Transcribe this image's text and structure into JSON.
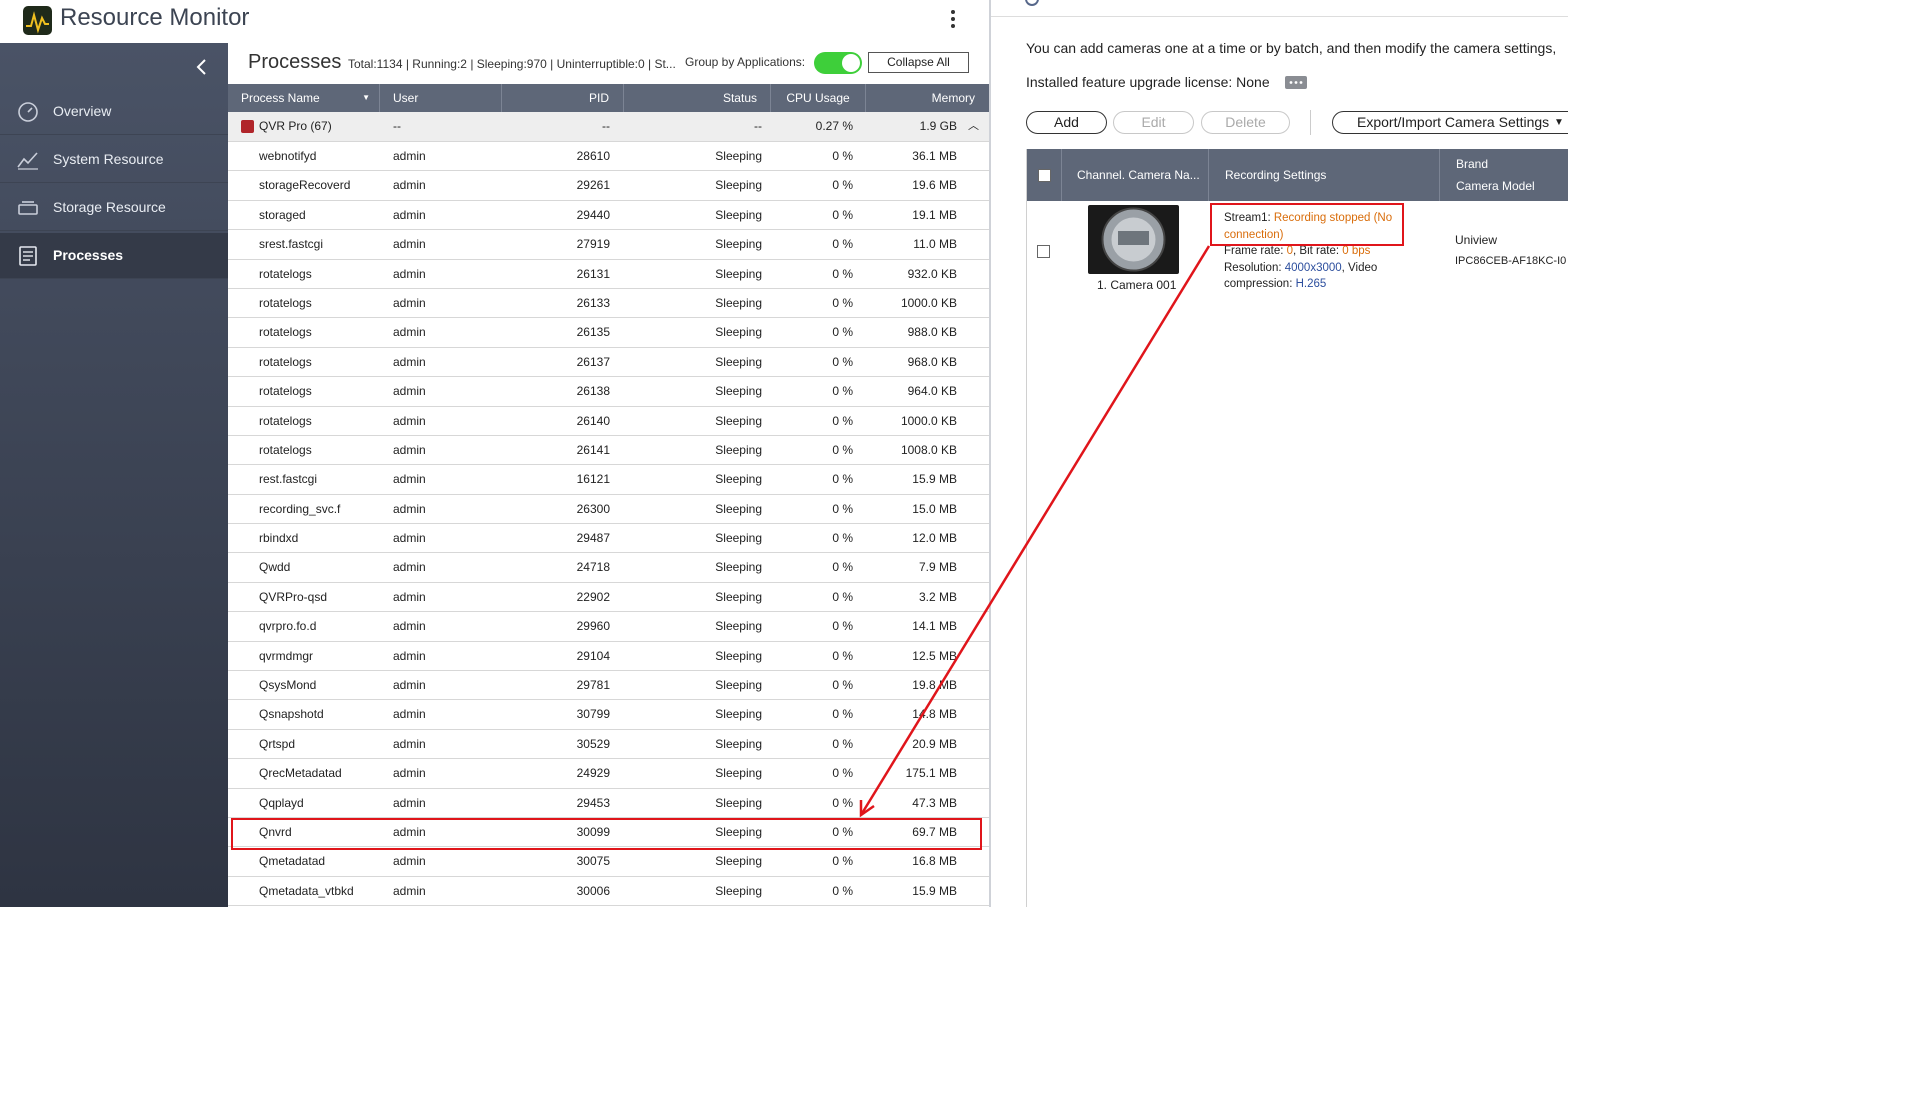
{
  "app": {
    "title": "Resource Monitor"
  },
  "sidebar": {
    "items": [
      {
        "label": "Overview",
        "icon": "gauge-icon"
      },
      {
        "label": "System Resource",
        "icon": "chart-line-icon"
      },
      {
        "label": "Storage Resource",
        "icon": "disk-icon"
      },
      {
        "label": "Processes",
        "icon": "document-list-icon",
        "active": true
      }
    ]
  },
  "processes": {
    "title": "Processes",
    "stats": "Total:1134 | Running:2 | Sleeping:970 | Uninterruptible:0 | St...",
    "group_label": "Group by Applications:",
    "collapse_label": "Collapse All",
    "columns": [
      "Process Name",
      "User",
      "PID",
      "Status",
      "CPU Usage",
      "Memory"
    ],
    "group": {
      "name": "QVR Pro (67)",
      "user": "--",
      "pid": "--",
      "status": "--",
      "cpu": "0.27 %",
      "memory": "1.9 GB"
    },
    "rows": [
      {
        "name": "webnotifyd",
        "user": "admin",
        "pid": "28610",
        "status": "Sleeping",
        "cpu": "0 %",
        "memory": "36.1 MB"
      },
      {
        "name": "storageRecoverd",
        "user": "admin",
        "pid": "29261",
        "status": "Sleeping",
        "cpu": "0 %",
        "memory": "19.6 MB"
      },
      {
        "name": "storaged",
        "user": "admin",
        "pid": "29440",
        "status": "Sleeping",
        "cpu": "0 %",
        "memory": "19.1 MB"
      },
      {
        "name": "srest.fastcgi",
        "user": "admin",
        "pid": "27919",
        "status": "Sleeping",
        "cpu": "0 %",
        "memory": "11.0 MB"
      },
      {
        "name": "rotatelogs",
        "user": "admin",
        "pid": "26131",
        "status": "Sleeping",
        "cpu": "0 %",
        "memory": "932.0 KB"
      },
      {
        "name": "rotatelogs",
        "user": "admin",
        "pid": "26133",
        "status": "Sleeping",
        "cpu": "0 %",
        "memory": "1000.0 KB"
      },
      {
        "name": "rotatelogs",
        "user": "admin",
        "pid": "26135",
        "status": "Sleeping",
        "cpu": "0 %",
        "memory": "988.0 KB"
      },
      {
        "name": "rotatelogs",
        "user": "admin",
        "pid": "26137",
        "status": "Sleeping",
        "cpu": "0 %",
        "memory": "968.0 KB"
      },
      {
        "name": "rotatelogs",
        "user": "admin",
        "pid": "26138",
        "status": "Sleeping",
        "cpu": "0 %",
        "memory": "964.0 KB"
      },
      {
        "name": "rotatelogs",
        "user": "admin",
        "pid": "26140",
        "status": "Sleeping",
        "cpu": "0 %",
        "memory": "1000.0 KB"
      },
      {
        "name": "rotatelogs",
        "user": "admin",
        "pid": "26141",
        "status": "Sleeping",
        "cpu": "0 %",
        "memory": "1008.0 KB"
      },
      {
        "name": "rest.fastcgi",
        "user": "admin",
        "pid": "16121",
        "status": "Sleeping",
        "cpu": "0 %",
        "memory": "15.9 MB"
      },
      {
        "name": "recording_svc.f",
        "user": "admin",
        "pid": "26300",
        "status": "Sleeping",
        "cpu": "0 %",
        "memory": "15.0 MB"
      },
      {
        "name": "rbindxd",
        "user": "admin",
        "pid": "29487",
        "status": "Sleeping",
        "cpu": "0 %",
        "memory": "12.0 MB"
      },
      {
        "name": "Qwdd",
        "user": "admin",
        "pid": "24718",
        "status": "Sleeping",
        "cpu": "0 %",
        "memory": "7.9 MB"
      },
      {
        "name": "QVRPro-qsd",
        "user": "admin",
        "pid": "22902",
        "status": "Sleeping",
        "cpu": "0 %",
        "memory": "3.2 MB"
      },
      {
        "name": "qvrpro.fo.d",
        "user": "admin",
        "pid": "29960",
        "status": "Sleeping",
        "cpu": "0 %",
        "memory": "14.1 MB"
      },
      {
        "name": "qvrmdmgr",
        "user": "admin",
        "pid": "29104",
        "status": "Sleeping",
        "cpu": "0 %",
        "memory": "12.5 MB"
      },
      {
        "name": "QsysMond",
        "user": "admin",
        "pid": "29781",
        "status": "Sleeping",
        "cpu": "0 %",
        "memory": "19.8 MB"
      },
      {
        "name": "Qsnapshotd",
        "user": "admin",
        "pid": "30799",
        "status": "Sleeping",
        "cpu": "0 %",
        "memory": "14.8 MB"
      },
      {
        "name": "Qrtspd",
        "user": "admin",
        "pid": "30529",
        "status": "Sleeping",
        "cpu": "0 %",
        "memory": "20.9 MB"
      },
      {
        "name": "QrecMetadatad",
        "user": "admin",
        "pid": "24929",
        "status": "Sleeping",
        "cpu": "0 %",
        "memory": "175.1 MB"
      },
      {
        "name": "Qqplayd",
        "user": "admin",
        "pid": "29453",
        "status": "Sleeping",
        "cpu": "0 %",
        "memory": "47.3 MB"
      },
      {
        "name": "Qnvrd",
        "user": "admin",
        "pid": "30099",
        "status": "Sleeping",
        "cpu": "0 %",
        "memory": "69.7 MB",
        "highlighted": true
      },
      {
        "name": "Qmetadatad",
        "user": "admin",
        "pid": "30075",
        "status": "Sleeping",
        "cpu": "0 %",
        "memory": "16.8 MB"
      },
      {
        "name": "Qmetadata_vtbkd",
        "user": "admin",
        "pid": "30006",
        "status": "Sleeping",
        "cpu": "0 %",
        "memory": "15.9 MB"
      }
    ]
  },
  "camera": {
    "intro": "You can add cameras one at a time or by batch, and then modify the camera settings,",
    "license": "Installed feature upgrade license: None",
    "buttons": {
      "add": "Add",
      "edit": "Edit",
      "delete": "Delete",
      "export_import": "Export/Import Camera Settings"
    },
    "columns": {
      "channel": "Channel. Camera Na...",
      "recording": "Recording Settings",
      "brand": "Brand",
      "model": "Camera Model"
    },
    "row": {
      "name": "1. Camera 001",
      "stream_label": "Stream1: ",
      "stream_status": "Recording stopped (No connection)",
      "frame_label": "Frame rate: ",
      "frame_value": "0",
      "bitrate_label": ", Bit rate: ",
      "bitrate_value": "0 bps",
      "resolution_label": "Resolution: ",
      "resolution_value": "4000x3000",
      "compression_label": ", Video compression: ",
      "compression_value": "H.265",
      "brand": "Uniview",
      "model": "IPC86CEB-AF18KC-I0"
    }
  },
  "colors": {
    "highlight": "#e0151b",
    "toggle_on": "#3ecf3a",
    "header_bg": "#5e6778",
    "status_orange": "#d96d0b",
    "value_blue": "#2d4f9e"
  }
}
